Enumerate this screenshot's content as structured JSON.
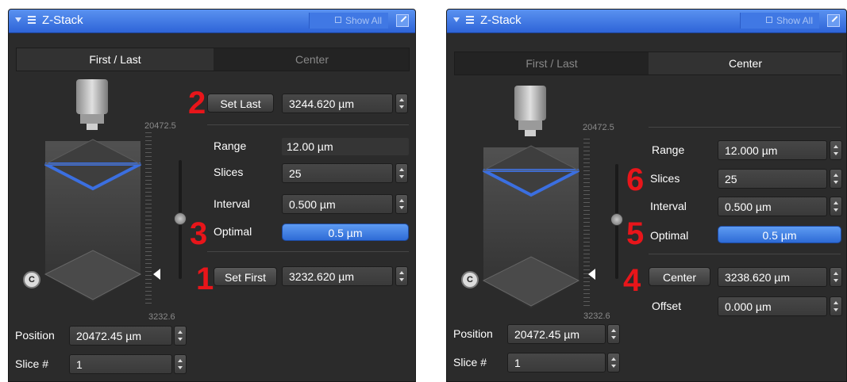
{
  "colors": {
    "title_bar": "#3a74e6",
    "accent_blue": "#3f7be6",
    "focal_plane": "#3b6fe0",
    "annotation_red": "#e8151a",
    "panel_bg": "#2b2b2b"
  },
  "icons": [
    "collapse-triangle-icon",
    "menu-icon",
    "show-all-icon",
    "popout-icon",
    "microscope-objective-icon",
    "center-c-icon",
    "position-marker-icon"
  ],
  "left": {
    "title": "Z-Stack",
    "show_all": "Show All",
    "tabs": [
      "First / Last",
      "Center"
    ],
    "active_tab": "First / Last",
    "scale_top": "20472.5",
    "scale_bottom": "3232.6",
    "set_last_label": "Set Last",
    "set_last_value": "3244.620 µm",
    "range_label": "Range",
    "range_value": "12.00 µm",
    "slices_label": "Slices",
    "slices_value": "25",
    "interval_label": "Interval",
    "interval_value": "0.500 µm",
    "optimal_label": "Optimal",
    "optimal_value": "0.5 µm",
    "set_first_label": "Set First",
    "set_first_value": "3232.620 µm",
    "position_label": "Position",
    "position_value": "20472.45 µm",
    "slice_label": "Slice #",
    "slice_value": "1",
    "center_icon_letter": "C",
    "annotations": {
      "set_last": "2",
      "optimal": "3",
      "set_first": "1"
    }
  },
  "right": {
    "title": "Z-Stack",
    "show_all": "Show All",
    "tabs": [
      "First / Last",
      "Center"
    ],
    "active_tab": "Center",
    "scale_top": "20472.5",
    "scale_bottom": "3232.6",
    "range_label": "Range",
    "range_value": "12.000 µm",
    "slices_label": "Slices",
    "slices_value": "25",
    "interval_label": "Interval",
    "interval_value": "0.500 µm",
    "optimal_label": "Optimal",
    "optimal_value": "0.5 µm",
    "center_label": "Center",
    "center_value": "3238.620 µm",
    "offset_label": "Offset",
    "offset_value": "0.000 µm",
    "position_label": "Position",
    "position_value": "20472.45 µm",
    "slice_label": "Slice #",
    "slice_value": "1",
    "center_icon_letter": "C",
    "annotations": {
      "slices": "6",
      "optimal": "5",
      "center": "4"
    }
  }
}
